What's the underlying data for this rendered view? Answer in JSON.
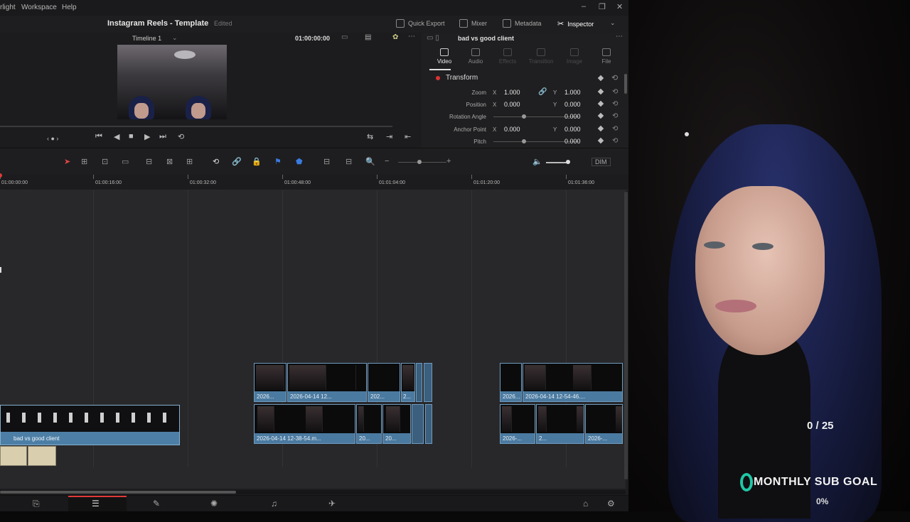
{
  "menu": {
    "items": [
      "rlight",
      "Workspace",
      "Help"
    ]
  },
  "window_controls": [
    "–",
    "❐",
    "✕"
  ],
  "project": {
    "title": "Instagram Reels - Template",
    "status": "Edited"
  },
  "toolbar": {
    "quick_export": "Quick Export",
    "mixer": "Mixer",
    "metadata": "Metadata",
    "inspector": "Inspector"
  },
  "viewer": {
    "timeline_name": "Timeline 1",
    "timecode": "01:00:00:00"
  },
  "inspector": {
    "clip_name": "bad vs good client",
    "tabs": [
      {
        "label": "Video",
        "state": "active"
      },
      {
        "label": "Audio",
        "state": "normal"
      },
      {
        "label": "Effects",
        "state": "disabled"
      },
      {
        "label": "Transition",
        "state": "disabled"
      },
      {
        "label": "Image",
        "state": "disabled"
      },
      {
        "label": "File",
        "state": "normal"
      }
    ],
    "section": "Transform",
    "props": {
      "zoom": {
        "label": "Zoom",
        "x": "1.000",
        "y": "1.000"
      },
      "position": {
        "label": "Position",
        "x": "0.000",
        "y": "0.000"
      },
      "rotation": {
        "label": "Rotation Angle",
        "value": "0.000"
      },
      "anchor": {
        "label": "Anchor Point",
        "x": "0.000",
        "y": "0.000"
      },
      "pitch": {
        "label": "Pitch",
        "value": "0.000"
      }
    },
    "axis_x": "X",
    "axis_y": "Y"
  },
  "timeline_toolbar": {
    "dim": "DIM"
  },
  "ruler": [
    "01:00:00:00",
    "01:00:16:00",
    "01:00:32:00",
    "01:00:48:00",
    "01:01:04:00",
    "01:01:20:00",
    "01:01:36:00"
  ],
  "clips": {
    "v2_a": [
      "2026...",
      "2026-04-14 12...",
      "202...",
      "2..."
    ],
    "v1_a": [
      "2026-04-14 12-38-54.m...",
      "20...",
      "20..."
    ],
    "v2_b": [
      "2026...",
      "2026-04-14 12-54-46...."
    ],
    "v1_b": [
      "2026-...",
      "2...",
      "2026-..."
    ],
    "adjustment": "bad vs good client"
  },
  "overlay": {
    "goal_count": "0 / 25",
    "goal_title": "MONTHLY SUB GOAL",
    "goal_percent": "0%",
    "goal_color": "#1fc7a6"
  },
  "accent_colors": {
    "playhead": "#e03a3a",
    "clip": "#4b7aa0"
  }
}
